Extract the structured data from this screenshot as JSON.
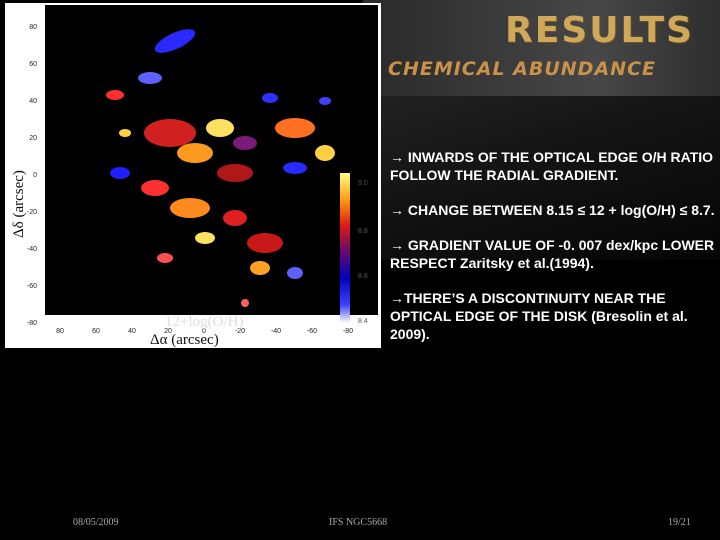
{
  "slide": {
    "title": "RESULTS",
    "subtitle": "CHEMICAL ABUNDANCE",
    "bullets": [
      "→ INWARDS  OF THE OPTICAL EDGE O/H RATIO FOLLOW THE RADIAL GRADIENT.",
      "→ CHANGE BETWEEN 8.15 ≤ 12 + log(O/H) ≤ 8.7.",
      "→ GRADIENT VALUE OF -0. 007 dex/kpc LOWER RESPECT Zaritsky et al.(1994).",
      "→THERE’S A DISCONTINUITY NEAR THE OPTICAL EDGE OF THE DISK (Bresolin et al. 2009)."
    ],
    "footer": {
      "date": "08/05/2009",
      "name": "IFS NGC5668",
      "page": "19/21"
    }
  },
  "figure": {
    "ylabel": "Δδ  (arcsec)",
    "xlabel": "Δα (arcsec)",
    "map_label": "12+log(O/H)",
    "y_ticks": [
      "80",
      "60",
      "40",
      "20",
      "0",
      "-20",
      "-40",
      "-60",
      "-80"
    ],
    "x_ticks": [
      "80",
      "60",
      "40",
      "20",
      "0",
      "-20",
      "-40",
      "-60",
      "-80"
    ],
    "colorbar_ticks": [
      "9.0",
      "8.8",
      "8.6",
      "8.4"
    ],
    "colors": {
      "low": "#0000ff",
      "mid": "#ff2020",
      "high": "#ffff60"
    }
  }
}
